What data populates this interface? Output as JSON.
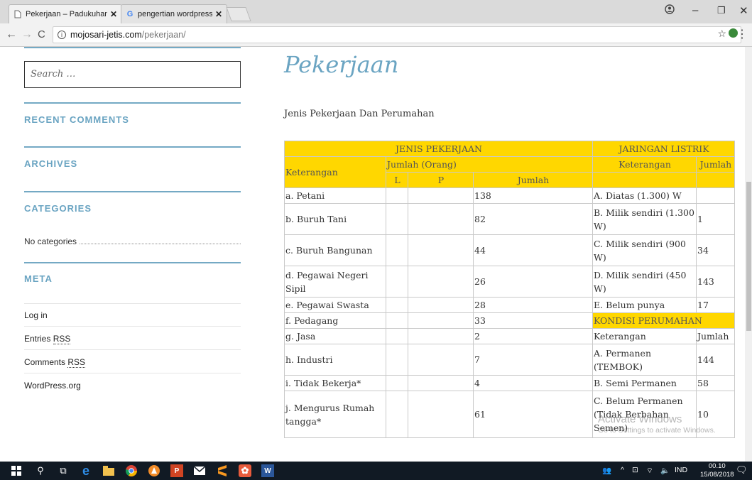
{
  "browser": {
    "tabs": [
      {
        "title": "Pekerjaan – Padukuhan N",
        "favicon": "page-icon"
      },
      {
        "title": "pengertian wordpress - P",
        "favicon": "google-icon"
      }
    ],
    "url_host": "mojosari-jetis.com",
    "url_path": "/pekerjaan/"
  },
  "sidebar": {
    "search_placeholder": "Search …",
    "recent_comments": "RECENT COMMENTS",
    "archives": "ARCHIVES",
    "categories": "CATEGORIES",
    "no_categories": "No categories",
    "meta": "META",
    "meta_links": {
      "login": "Log in",
      "entries_pre": "Entries ",
      "entries_rss": "RSS",
      "comments_pre": "Comments ",
      "comments_rss": "RSS",
      "wordpress": "WordPress.org"
    }
  },
  "main": {
    "title": "Pekerjaan",
    "subtitle": "Jenis Pekerjaan Dan Perumahan",
    "table": {
      "h_jenis": "JENIS PEKERJAAN",
      "h_jaringan": "JARINGAN  LISTRIK",
      "h_keterangan": "Keterangan",
      "h_jumlah_orang": "Jumlah (Orang)",
      "h_keterangan2": "Keterangan",
      "h_jumlah2": "Jumlah",
      "h_L": "L",
      "h_P": "P",
      "h_jumlah": "Jumlah",
      "rows": [
        {
          "ket": "a. Petani",
          "jml": "138",
          "ket2": "A. Diatas (1.300) W",
          "jml2": ""
        },
        {
          "ket": "b. Buruh Tani",
          "jml": "82",
          "ket2": "B. Milik sendiri (1.300 W)",
          "jml2": "1"
        },
        {
          "ket": "c. Buruh Bangunan",
          "jml": "44",
          "ket2": "C. Milik sendiri (900 W)",
          "jml2": "34"
        },
        {
          "ket": "d. Pegawai Negeri Sipil",
          "jml": "26",
          "ket2": "D. Milik sendiri (450 W)",
          "jml2": "143"
        },
        {
          "ket": "e. Pegawai Swasta",
          "jml": "28",
          "ket2": "E. Belum punya",
          "jml2": "17"
        },
        {
          "ket": "f. Pedagang",
          "jml": "33",
          "ket2": "KONDISI PERUMAHAN",
          "jml2": ""
        },
        {
          "ket": "g. Jasa",
          "jml": "2",
          "ket2": "Keterangan",
          "jml2": "Jumlah"
        },
        {
          "ket": "h. Industri",
          "jml": "7",
          "ket2": "A. Permanen (TEMBOK)",
          "jml2": "144"
        },
        {
          "ket": "i. Tidak Bekerja*",
          "jml": "4",
          "ket2": "B. Semi Permanen",
          "jml2": "58"
        },
        {
          "ket": "j. Mengurus Rumah tangga*",
          "jml": "61",
          "ket2": "C. Belum Permanen (Tidak Berbahan Semen)",
          "jml2": "10"
        }
      ]
    }
  },
  "watermark": {
    "line1": "Activate Windows",
    "line2": "Go to Settings to activate Windows."
  },
  "taskbar": {
    "lang": "IND",
    "time": "00.10",
    "date": "15/08/2018"
  },
  "colors": {
    "accent": "#74a9c4",
    "table_header_yellow": "#ffd700",
    "taskbar": "#111a24"
  }
}
